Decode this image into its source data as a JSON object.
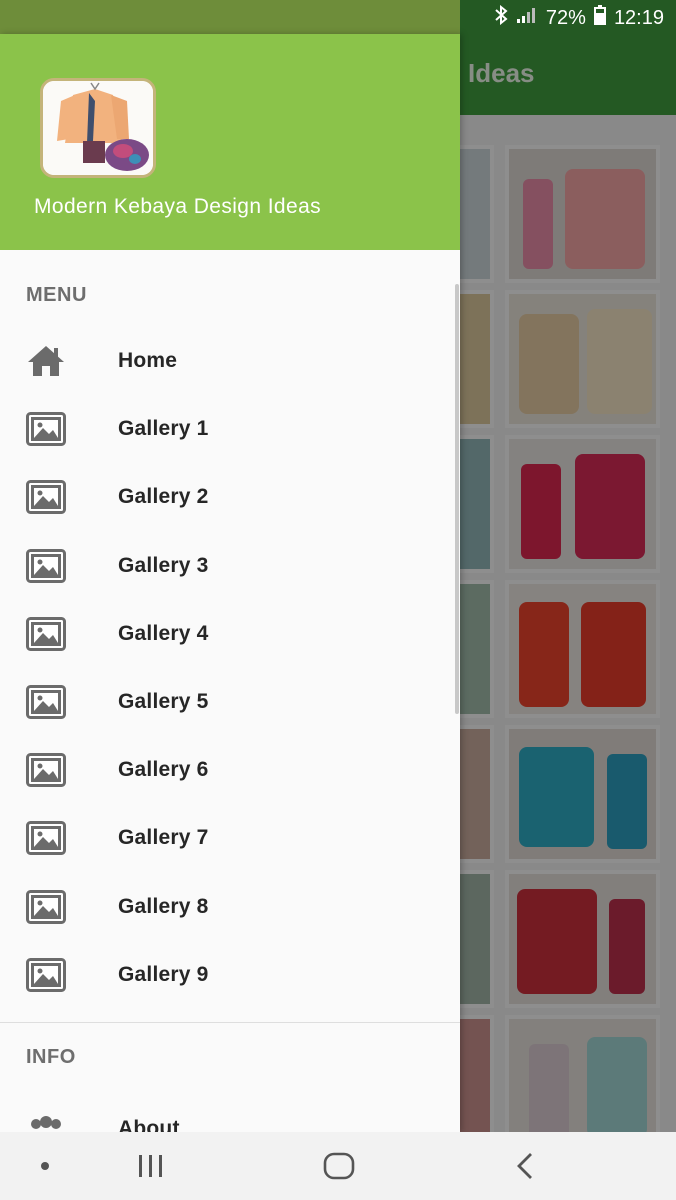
{
  "status_bar": {
    "battery": "72%",
    "time": "12:19"
  },
  "background_app": {
    "title": "Ideas"
  },
  "drawer": {
    "app_name": "Modern Kebaya Design Ideas",
    "menu_section": "MENU",
    "menu_items": [
      {
        "label": "Home",
        "icon": "home-icon"
      },
      {
        "label": "Gallery 1",
        "icon": "image-icon"
      },
      {
        "label": "Gallery 2",
        "icon": "image-icon"
      },
      {
        "label": "Gallery 3",
        "icon": "image-icon"
      },
      {
        "label": "Gallery 4",
        "icon": "image-icon"
      },
      {
        "label": "Gallery 5",
        "icon": "image-icon"
      },
      {
        "label": "Gallery 6",
        "icon": "image-icon"
      },
      {
        "label": "Gallery 7",
        "icon": "image-icon"
      },
      {
        "label": "Gallery 8",
        "icon": "image-icon"
      },
      {
        "label": "Gallery 9",
        "icon": "image-icon"
      }
    ],
    "info_section": "INFO",
    "info_items": [
      {
        "label": "About",
        "icon": "people-icon"
      }
    ]
  },
  "colors": {
    "header_green": "#8bc34a",
    "toolbar_green": "#3f9a3d",
    "icon_grey": "#6b6b6b"
  }
}
